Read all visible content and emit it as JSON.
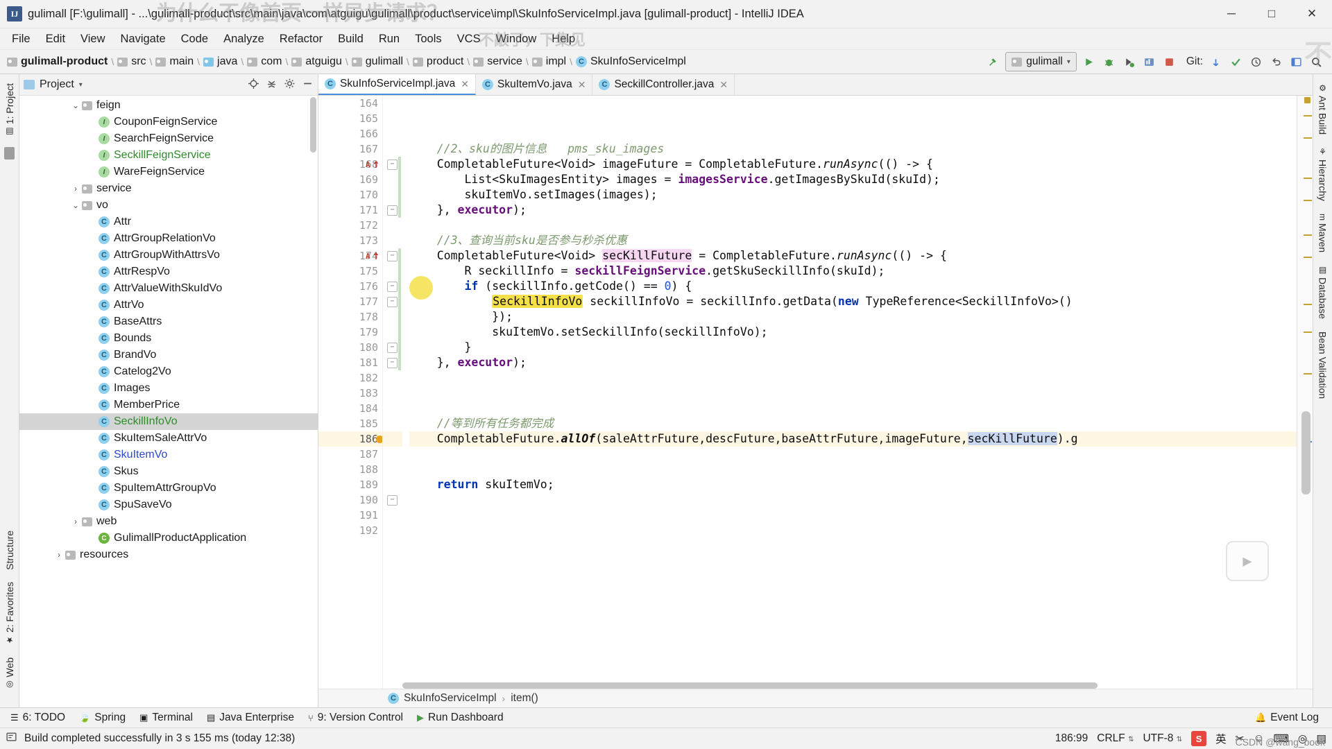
{
  "window": {
    "title": "gulimall [F:\\gulimall] - ...\\gulimall-product\\src\\main\\java\\com\\atguigu\\gulimall\\product\\service\\impl\\SkuInfoServiceImpl.java [gulimall-product] - IntelliJ IDEA",
    "app_icon": "IJ",
    "minimize": "─",
    "maximize": "□",
    "close": "✕",
    "watermarks": [
      "为什么不像首页一样异步请求？",
      "不敲了，下集见",
      "不"
    ]
  },
  "menu": {
    "items": [
      "File",
      "Edit",
      "View",
      "Navigate",
      "Code",
      "Analyze",
      "Refactor",
      "Build",
      "Run",
      "Tools",
      "VCS",
      "Window",
      "Help"
    ]
  },
  "breadcrumb": {
    "items": [
      {
        "label": "gulimall-product",
        "icon": "module-icon",
        "bold": true
      },
      {
        "label": "src",
        "icon": "folder-icon"
      },
      {
        "label": "main",
        "icon": "folder-icon"
      },
      {
        "label": "java",
        "icon": "source-folder-icon"
      },
      {
        "label": "com",
        "icon": "package-icon"
      },
      {
        "label": "atguigu",
        "icon": "package-icon"
      },
      {
        "label": "gulimall",
        "icon": "package-icon"
      },
      {
        "label": "product",
        "icon": "package-icon"
      },
      {
        "label": "service",
        "icon": "package-icon"
      },
      {
        "label": "impl",
        "icon": "package-icon"
      },
      {
        "label": "SkuInfoServiceImpl",
        "icon": "class-icon"
      }
    ]
  },
  "toolbar": {
    "run_config": "gulimall",
    "run_config_icon": "module-icon",
    "build_icon": "hammer-icon",
    "run_icon": "run-icon",
    "debug_icon": "debug-icon",
    "run_coverage_icon": "coverage-icon",
    "profile_icon": "profile-icon",
    "stop_icon": "stop-icon",
    "git_label": "Git:",
    "update_icon": "update-project-icon",
    "commit_icon": "commit-icon",
    "history_icon": "history-icon",
    "rollback_icon": "rollback-icon",
    "layout_icon": "layout-icon",
    "search_icon": "search-icon"
  },
  "project_panel": {
    "title": "Project",
    "dropdown_icon": "chevron-down-icon",
    "panel_icon": "project-icon",
    "locate_icon": "scroll-from-source-icon",
    "collapse_icon": "collapse-all-icon",
    "settings_icon": "gear-icon",
    "hide_icon": "hide-icon",
    "tree": [
      {
        "label": "feign",
        "type": "folder",
        "indent": 3,
        "arrow": "down"
      },
      {
        "label": "CouponFeignService",
        "type": "interface",
        "indent": 4,
        "arrow": ""
      },
      {
        "label": "SearchFeignService",
        "type": "interface",
        "indent": 4,
        "arrow": ""
      },
      {
        "label": "SeckillFeignService",
        "type": "interface",
        "indent": 4,
        "arrow": "",
        "color": "green"
      },
      {
        "label": "WareFeignService",
        "type": "interface",
        "indent": 4,
        "arrow": ""
      },
      {
        "label": "service",
        "type": "folder",
        "indent": 3,
        "arrow": "right"
      },
      {
        "label": "vo",
        "type": "folder",
        "indent": 3,
        "arrow": "down"
      },
      {
        "label": "Attr",
        "type": "class",
        "indent": 4,
        "arrow": ""
      },
      {
        "label": "AttrGroupRelationVo",
        "type": "class",
        "indent": 4,
        "arrow": ""
      },
      {
        "label": "AttrGroupWithAttrsVo",
        "type": "class",
        "indent": 4,
        "arrow": ""
      },
      {
        "label": "AttrRespVo",
        "type": "class",
        "indent": 4,
        "arrow": ""
      },
      {
        "label": "AttrValueWithSkuIdVo",
        "type": "class",
        "indent": 4,
        "arrow": ""
      },
      {
        "label": "AttrVo",
        "type": "class",
        "indent": 4,
        "arrow": ""
      },
      {
        "label": "BaseAttrs",
        "type": "class",
        "indent": 4,
        "arrow": ""
      },
      {
        "label": "Bounds",
        "type": "class",
        "indent": 4,
        "arrow": ""
      },
      {
        "label": "BrandVo",
        "type": "class",
        "indent": 4,
        "arrow": ""
      },
      {
        "label": "Catelog2Vo",
        "type": "class",
        "indent": 4,
        "arrow": ""
      },
      {
        "label": "Images",
        "type": "class",
        "indent": 4,
        "arrow": ""
      },
      {
        "label": "MemberPrice",
        "type": "class",
        "indent": 4,
        "arrow": ""
      },
      {
        "label": "SeckillInfoVo",
        "type": "class",
        "indent": 4,
        "arrow": "",
        "color": "green",
        "selected": true
      },
      {
        "label": "SkuItemSaleAttrVo",
        "type": "class",
        "indent": 4,
        "arrow": ""
      },
      {
        "label": "SkuItemVo",
        "type": "class",
        "indent": 4,
        "arrow": "",
        "color": "blue"
      },
      {
        "label": "Skus",
        "type": "class",
        "indent": 4,
        "arrow": ""
      },
      {
        "label": "SpuItemAttrGroupVo",
        "type": "class",
        "indent": 4,
        "arrow": ""
      },
      {
        "label": "SpuSaveVo",
        "type": "class",
        "indent": 4,
        "arrow": ""
      },
      {
        "label": "web",
        "type": "folder",
        "indent": 3,
        "arrow": "right"
      },
      {
        "label": "GulimallProductApplication",
        "type": "spring",
        "indent": 4,
        "arrow": ""
      },
      {
        "label": "resources",
        "type": "folder",
        "indent": 2,
        "arrow": "right"
      }
    ]
  },
  "editor": {
    "tabs": [
      {
        "label": "SkuInfoServiceImpl.java",
        "icon": "class-icon",
        "active": true,
        "close": "✕"
      },
      {
        "label": "SkuItemVo.java",
        "icon": "class-icon",
        "active": false,
        "close": "✕"
      },
      {
        "label": "SeckillController.java",
        "icon": "class-icon",
        "active": false,
        "close": "✕"
      }
    ],
    "first_line": 164,
    "lines": [
      {
        "n": 164,
        "text": ""
      },
      {
        "n": 165,
        "text": ""
      },
      {
        "n": 166,
        "text": ""
      },
      {
        "n": 167,
        "text": "    //2、sku的图片信息   pms_sku_images",
        "kind": "comment"
      },
      {
        "n": 168,
        "text": "    CompletableFuture<Void> imageFuture = CompletableFuture.runAsync(() -> {",
        "gutter_mark": "annotate-up",
        "fold": "minus"
      },
      {
        "n": 169,
        "text": "        List<SkuImagesEntity> images = imagesService.getImagesBySkuId(skuId);"
      },
      {
        "n": 170,
        "text": "        skuItemVo.setImages(images);"
      },
      {
        "n": 171,
        "text": "    }, executor);",
        "fold": "minus"
      },
      {
        "n": 172,
        "text": ""
      },
      {
        "n": 173,
        "text": "    //3、查询当前sku是否参与秒杀优惠",
        "kind": "comment"
      },
      {
        "n": 174,
        "text": "    CompletableFuture<Void> secKillFuture = CompletableFuture.runAsync(() -> {",
        "gutter_mark": "annotate-up",
        "fold": "minus"
      },
      {
        "n": 175,
        "text": "        R seckillInfo = seckillFeignService.getSkuSeckillInfo(skuId);"
      },
      {
        "n": 176,
        "text": "        if (seckillInfo.getCode() == 0) {",
        "fold": "minus"
      },
      {
        "n": 177,
        "text": "            SeckillInfoVo seckillInfoVo = seckillInfo.getData(new TypeReference<SeckillInfoVo>()",
        "fold": "minus"
      },
      {
        "n": 178,
        "text": "            });"
      },
      {
        "n": 179,
        "text": "            skuItemVo.setSeckillInfo(seckillInfoVo);"
      },
      {
        "n": 180,
        "text": "        }",
        "fold": "minus"
      },
      {
        "n": 181,
        "text": "    }, executor);",
        "fold": "minus"
      },
      {
        "n": 182,
        "text": ""
      },
      {
        "n": 183,
        "text": ""
      },
      {
        "n": 184,
        "text": ""
      },
      {
        "n": 185,
        "text": "    //等到所有任务都完成",
        "kind": "comment"
      },
      {
        "n": 186,
        "text": "    CompletableFuture.allOf(saleAttrFuture,descFuture,baseAttrFuture,imageFuture,secKillFuture).g",
        "current": true,
        "breakpoint_dot": true
      },
      {
        "n": 187,
        "text": ""
      },
      {
        "n": 188,
        "text": ""
      },
      {
        "n": 189,
        "text": "    return skuItemVo;"
      },
      {
        "n": 190,
        "text": "",
        "fold": "minus"
      },
      {
        "n": 191,
        "text": ""
      },
      {
        "n": 192,
        "text": ""
      }
    ],
    "bottom_breadcrumb": [
      "SkuInfoServiceImpl",
      "item()"
    ],
    "bottom_breadcrumb_sep": "›"
  },
  "left_rail": {
    "items": [
      {
        "label": "1: Project",
        "icon": "project-icon"
      },
      {
        "label": "Structure",
        "icon": "structure-icon"
      },
      {
        "label": "2: Favorites",
        "icon": "star-icon"
      },
      {
        "label": "Web",
        "icon": "web-icon"
      }
    ]
  },
  "right_rail": {
    "items": [
      {
        "label": "Ant Build",
        "icon": "ant-icon"
      },
      {
        "label": "Hierarchy",
        "icon": "hierarchy-icon"
      },
      {
        "label": "Maven",
        "icon": "maven-icon"
      },
      {
        "label": "Database",
        "icon": "database-icon"
      },
      {
        "label": "Bean Validation",
        "icon": "bean-icon"
      }
    ]
  },
  "bottom_tabs": {
    "items": [
      {
        "label": "6: TODO",
        "icon": "todo-icon"
      },
      {
        "label": "Spring",
        "icon": "spring-icon"
      },
      {
        "label": "Terminal",
        "icon": "terminal-icon"
      },
      {
        "label": "Java Enterprise",
        "icon": "java-ee-icon"
      },
      {
        "label": "9: Version Control",
        "icon": "vcs-icon"
      },
      {
        "label": "Run Dashboard",
        "icon": "run-icon"
      }
    ],
    "event_log": "Event Log",
    "event_log_icon": "bell-icon"
  },
  "status_bar": {
    "message": "Build completed successfully in 3 s 155 ms (today 12:38)",
    "message_icon": "build-icon",
    "caret": "186:99",
    "line_separator": "CRLF",
    "encoding": "UTF-8",
    "ime_language": "英",
    "ime_icon": "sogou-icon",
    "lock_icon": "lock-icon",
    "sogou_label": "S",
    "extras": [
      "✂",
      "☺",
      "⌨",
      "◎",
      "▤"
    ],
    "watermark": "CSDN @wang_book"
  },
  "colors": {
    "accent": "#4a90d9",
    "selection": "#d4d4d4",
    "comment": "#7d9a6e",
    "keyword": "#0033b3",
    "field": "#660e7a",
    "highlight_pink": "#f7d6f2",
    "highlight_blue": "#c9d8f0",
    "highlight_yellow": "#f5e04a",
    "current_line": "#fdf6e3"
  }
}
